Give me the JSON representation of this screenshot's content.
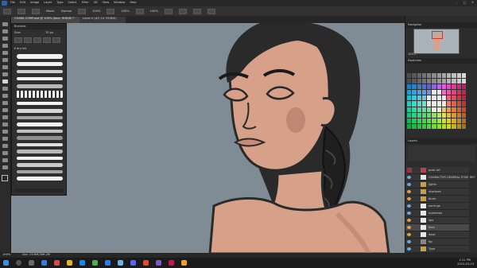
{
  "menu": {
    "items": [
      "File",
      "Edit",
      "Image",
      "Layer",
      "Type",
      "Select",
      "Filter",
      "3D",
      "View",
      "Window",
      "Help"
    ],
    "window_controls": [
      "–",
      "□",
      "✕"
    ]
  },
  "options": {
    "mode_label": "Mode:",
    "mode_value": "Normal",
    "opacity": "100%",
    "flow": "100%",
    "smoothing": "100%"
  },
  "tabs": [
    {
      "label": "CHARA COMP.psd @ 100% (face, RGB/8) *"
    },
    {
      "label": "Layer 0 (#2 24, RGB/8)"
    }
  ],
  "brushes": {
    "title": "Brushes",
    "size_label": "Size:",
    "size_value": "70 px",
    "folder": "▾ dry ink"
  },
  "navigator": {
    "title": "Navigator",
    "zoom": "100%"
  },
  "swatches": {
    "title": "Swatches"
  },
  "layers": {
    "title": "Layers",
    "items": [
      {
        "name": "pose ref"
      },
      {
        "name": "CHARACTER GENERAL POSE REF"
      },
      {
        "name": "lights"
      },
      {
        "name": "shadows"
      },
      {
        "name": "blush"
      },
      {
        "name": "earrings"
      },
      {
        "name": "eyebrows"
      },
      {
        "name": "lips"
      },
      {
        "name": "face"
      },
      {
        "name": "base"
      },
      {
        "name": "bg"
      },
      {
        "name": "Type"
      }
    ]
  },
  "status": {
    "zoom": "100%",
    "doc": "Doc: 20.6M/346.2M"
  },
  "taskbar": {
    "clock_time": "2:11 PM",
    "clock_date": "2022-03-23"
  },
  "colors": {
    "accent": "#2a64a8",
    "canvas_bg": "#7f8c96",
    "skin": "#d6a188",
    "hair": "#2a2a2a"
  }
}
